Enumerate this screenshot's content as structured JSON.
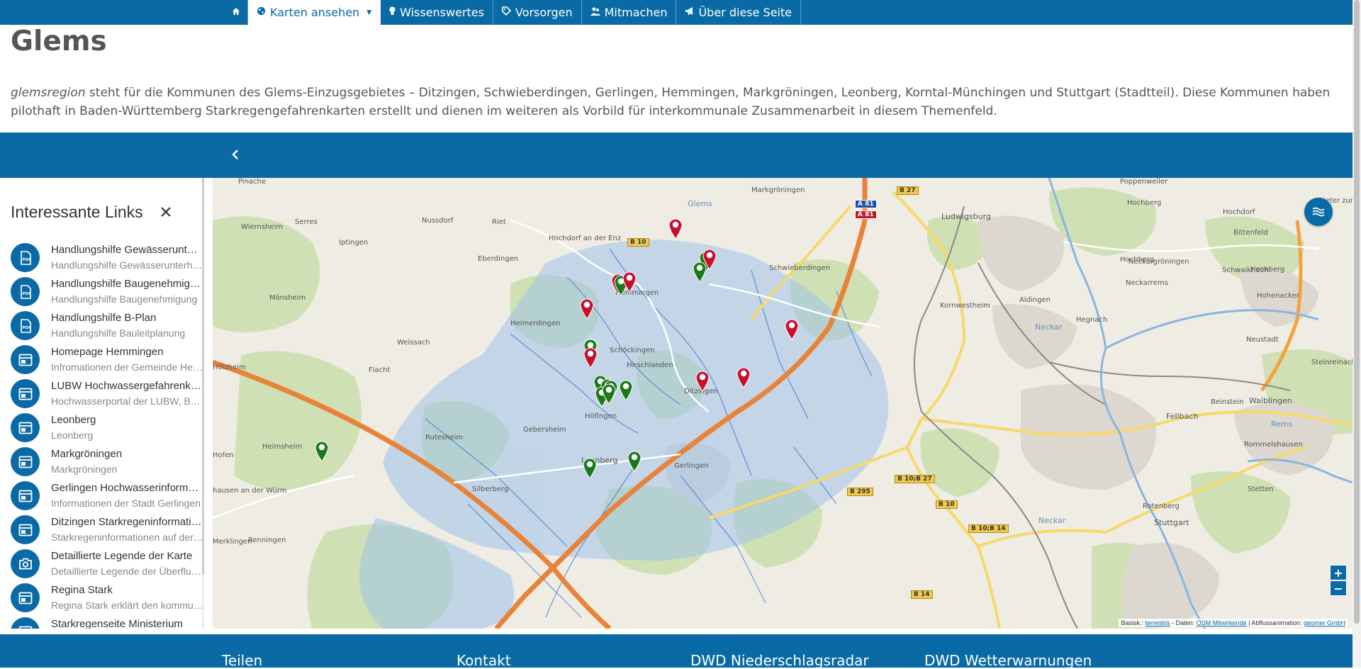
{
  "nav": {
    "items": [
      {
        "label": "Karten ansehen",
        "icon": "globe-icon",
        "active": true,
        "dropdown": true
      },
      {
        "label": "Wissenswertes",
        "icon": "lightbulb-icon"
      },
      {
        "label": "Vorsorgen",
        "icon": "tag-icon"
      },
      {
        "label": "Mitmachen",
        "icon": "users-icon"
      },
      {
        "label": "Über diese Seite",
        "icon": "bullhorn-icon"
      }
    ]
  },
  "page": {
    "title": "Glems",
    "intro_em": "glemsregion",
    "intro_text": " steht für die Kommunen des Glems-Einzugsgebietes – Ditzingen, Schwieberdingen, Gerlingen, Hemmingen, Markgröningen, Leonberg, Korntal-Münchingen und Stuttgart (Stadtteil). Diese Kommunen haben pilothaft in Baden-Württemberg Starkregengefahrenkarten erstellt und dienen im weiteren als Vorbild für interkommunale Zusammenarbeit in diesem Themenfeld."
  },
  "toolbar": {
    "back_icon": "chevron-left-icon"
  },
  "sidebar": {
    "title": "Interessante Links",
    "close_icon": "close-icon",
    "links": [
      {
        "title": "Handlungshilfe Gewässerunterhaltung",
        "sub": "Handlungshilfe Gewässerunterhaltung",
        "icon": "pdf-icon"
      },
      {
        "title": "Handlungshilfe Baugenehmigung",
        "sub": "Handlungshilfe Baugenehmigung",
        "icon": "pdf-icon"
      },
      {
        "title": "Handlungshilfe B-Plan",
        "sub": "Handlungshilfe Bauleitplanung",
        "icon": "pdf-icon"
      },
      {
        "title": "Homepage Hemmingen",
        "sub": "Infromationen der Gemeinde Hemmingen",
        "icon": "browser-icon"
      },
      {
        "title": "LUBW Hochwassergefahrenkarten",
        "sub": "Hochwasserportal der LUBW, Baden-Württemberg",
        "icon": "browser-icon"
      },
      {
        "title": "Leonberg",
        "sub": "Leonberg",
        "icon": "browser-icon"
      },
      {
        "title": "Markgröningen",
        "sub": "Markgröningen",
        "icon": "browser-icon"
      },
      {
        "title": "Gerlingen Hochwasserinformationen",
        "sub": "Informationen der Stadt Gerlingen",
        "icon": "browser-icon"
      },
      {
        "title": "Ditzingen Starkregeninformationen",
        "sub": "Starkregeninformationen auf der Seite",
        "icon": "browser-icon"
      },
      {
        "title": "Detaillierte Legende der Karte",
        "sub": "Detaillierte Legende der Überflutungskarte",
        "icon": "camera-icon"
      },
      {
        "title": "Regina Stark",
        "sub": "Regina Stark erklärt den kommunalen Ansatz",
        "icon": "browser-icon"
      },
      {
        "title": "Starkregenseite Ministerium",
        "sub": "",
        "icon": "browser-icon"
      }
    ]
  },
  "map": {
    "places": [
      {
        "name": "Pinache",
        "kind": "town"
      },
      {
        "name": "Glems",
        "kind": "river"
      },
      {
        "name": "Markgröningen",
        "kind": "town"
      },
      {
        "name": "Poppenweiler",
        "kind": "town"
      },
      {
        "name": "Hochberg",
        "kind": "town"
      },
      {
        "name": "Ludwigsburg",
        "kind": "city"
      },
      {
        "name": "Hochdorf",
        "kind": "town"
      },
      {
        "name": "Wiernsheim",
        "kind": "town"
      },
      {
        "name": "Serres",
        "kind": "town"
      },
      {
        "name": "Nussdorf",
        "kind": "town"
      },
      {
        "name": "Riet",
        "kind": "town"
      },
      {
        "name": "Iptingen",
        "kind": "town"
      },
      {
        "name": "Hochdorf an der Enz",
        "kind": "town"
      },
      {
        "name": "Eberdingen",
        "kind": "town"
      },
      {
        "name": "Schwieberdingen",
        "kind": "town"
      },
      {
        "name": "Hochberg",
        "kind": "town"
      },
      {
        "name": "Bittenfeld",
        "kind": "town"
      },
      {
        "name": "Neckargröningen",
        "kind": "town"
      },
      {
        "name": "Schwaikheim",
        "kind": "town"
      },
      {
        "name": "Neckarrems",
        "kind": "town"
      },
      {
        "name": "Mönsheim",
        "kind": "town"
      },
      {
        "name": "Hemmingen",
        "kind": "town"
      },
      {
        "name": "Kornwestheim",
        "kind": "town"
      },
      {
        "name": "Aldingen",
        "kind": "town"
      },
      {
        "name": "Hohenacker",
        "kind": "town"
      },
      {
        "name": "Neckar",
        "kind": "river"
      },
      {
        "name": "Hegnach",
        "kind": "town"
      },
      {
        "name": "Heimerdingen",
        "kind": "town"
      },
      {
        "name": "Weissach",
        "kind": "town"
      },
      {
        "name": "Schöckingen",
        "kind": "town"
      },
      {
        "name": "Neustadt",
        "kind": "town"
      },
      {
        "name": "Hirschlanden",
        "kind": "town"
      },
      {
        "name": "Steinreinach",
        "kind": "town"
      },
      {
        "name": "Flacht",
        "kind": "town"
      },
      {
        "name": "Ditzingen",
        "kind": "town"
      },
      {
        "name": "Waiblingen",
        "kind": "city"
      },
      {
        "name": "Beinstein",
        "kind": "town"
      },
      {
        "name": "Höfingen",
        "kind": "town"
      },
      {
        "name": "Fellbach",
        "kind": "city"
      },
      {
        "name": "Rems",
        "kind": "river"
      },
      {
        "name": "Heimsheim",
        "kind": "town"
      },
      {
        "name": "Gebersheim",
        "kind": "town"
      },
      {
        "name": "Rutesheim",
        "kind": "town"
      },
      {
        "name": "Leonberg",
        "kind": "city"
      },
      {
        "name": "Gerlingen",
        "kind": "town"
      },
      {
        "name": "Rommelshausen",
        "kind": "town"
      },
      {
        "name": "Silberberg",
        "kind": "town"
      },
      {
        "name": "Stetten",
        "kind": "town"
      },
      {
        "name": "Stuttgart",
        "kind": "city"
      },
      {
        "name": "Rotenberg",
        "kind": "town"
      },
      {
        "name": "Neckar",
        "kind": "river"
      },
      {
        "name": "Renningen",
        "kind": "town"
      },
      {
        "name": "Merklingen",
        "kind": "town"
      },
      {
        "name": "hausen an der Würm",
        "kind": "town"
      },
      {
        "name": "Hofen",
        "kind": "town"
      },
      {
        "name": "Hölzheim",
        "kind": "town"
      },
      {
        "name": "Hochberg",
        "kind": "town"
      },
      {
        "name": "Rieter zum",
        "kind": "town"
      }
    ],
    "shields": [
      "B 27",
      "A 81",
      "A 81",
      "B 10",
      "B 10;B 27",
      "B 295",
      "B 10",
      "B 10;B 14",
      "B 14"
    ],
    "layers_icon": "layers-icon",
    "zoom_in": "+",
    "zoom_out": "−",
    "attribution": {
      "prefix": "Basisk.: ",
      "link1": "terrestris",
      "mid1": " - Daten: ",
      "link2": "OSM Mitwirkende",
      "mid2": " | Abflussanimation: ",
      "link3": "geomer GmbH"
    },
    "markers": [
      {
        "color": "red"
      },
      {
        "color": "green"
      },
      {
        "color": "red"
      },
      {
        "color": "green"
      },
      {
        "color": "red"
      },
      {
        "color": "green"
      },
      {
        "color": "red"
      },
      {
        "color": "red"
      },
      {
        "color": "red"
      },
      {
        "color": "green"
      },
      {
        "color": "red"
      },
      {
        "color": "green"
      },
      {
        "color": "green"
      },
      {
        "color": "green"
      },
      {
        "color": "green"
      },
      {
        "color": "green"
      },
      {
        "color": "red"
      },
      {
        "color": "red"
      },
      {
        "color": "green"
      },
      {
        "color": "green"
      },
      {
        "color": "green"
      },
      {
        "color": "green"
      }
    ],
    "colors": {
      "red": "#c8102e",
      "green": "#1a7a1a",
      "brand": "#0a6aa5"
    }
  },
  "footer": {
    "headings": [
      "Teilen",
      "Kontakt",
      "DWD Niederschlagsradar",
      "DWD Wetterwarnungen"
    ]
  }
}
